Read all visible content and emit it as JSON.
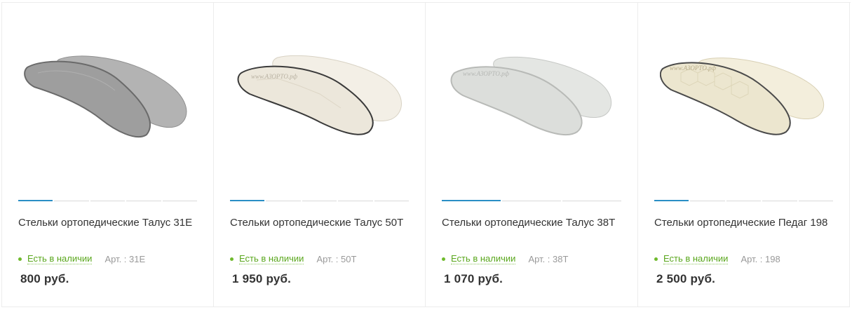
{
  "products": [
    {
      "title": "Стельки ортопедические Талус 31Е",
      "stock": "Есть в наличии",
      "article": "Арт. : 31E",
      "price": "800 руб.",
      "gallery_segments": 5,
      "gallery_active": 1,
      "colors": {
        "top": "#9c9c9c",
        "top_light": "#b5b5b5",
        "edge": "#6a6a6a"
      }
    },
    {
      "title": "Стельки ортопедические Талус 50Т",
      "stock": "Есть в наличии",
      "article": "Арт. : 50T",
      "price": "1 950 руб.",
      "gallery_segments": 5,
      "gallery_active": 1,
      "watermark": "www.АЗОРТО.рф",
      "colors": {
        "top": "#ece7db",
        "top_light": "#f6f2ea",
        "edge": "#3a3a3a"
      }
    },
    {
      "title": "Стельки ортопедические Талус 38Т",
      "stock": "Есть в наличии",
      "article": "Арт. : 38T",
      "price": "1 070 руб.",
      "gallery_segments": 3,
      "gallery_active": 1,
      "watermark": "www.АЗОРТО.рф",
      "colors": {
        "top": "#dcdedb",
        "top_light": "#e9ebe8",
        "edge": "#b8bab7"
      }
    },
    {
      "title": "Стельки ортопедические Педаг 198",
      "stock": "Есть в наличии",
      "article": "Арт. : 198",
      "price": "2 500 руб.",
      "gallery_segments": 5,
      "gallery_active": 1,
      "watermark": "www.АЗОРТО.рф",
      "colors": {
        "top": "#ece6cf",
        "top_light": "#f5f1e1",
        "edge": "#4a4a4a"
      }
    }
  ]
}
